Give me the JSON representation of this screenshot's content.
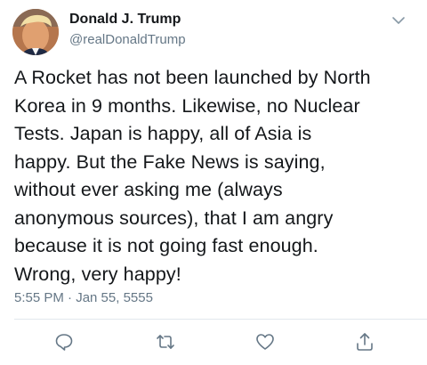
{
  "tweet": {
    "author_name": "Donald J. Trump",
    "author_handle": "@realDonaldTrump",
    "text_lines": [
      "A Rocket has not been launched by North",
      "Korea in 9 months. Likewise, no Nuclear",
      "Tests. Japan is happy, all of Asia is",
      "happy. But the Fake News is saying,",
      "without ever asking me (always",
      "anonymous sources), that I am angry",
      "because it is not going fast enough.",
      "Wrong, very happy!"
    ],
    "timestamp": "5:55 PM · Jan 55, 5555"
  },
  "icons": {
    "menu": "chevron-down-icon",
    "reply": "reply-icon",
    "retweet": "retweet-icon",
    "like": "heart-icon",
    "share": "share-icon"
  },
  "colors": {
    "text": "#14171a",
    "secondary": "#657786",
    "divider": "#e1e8ed"
  }
}
